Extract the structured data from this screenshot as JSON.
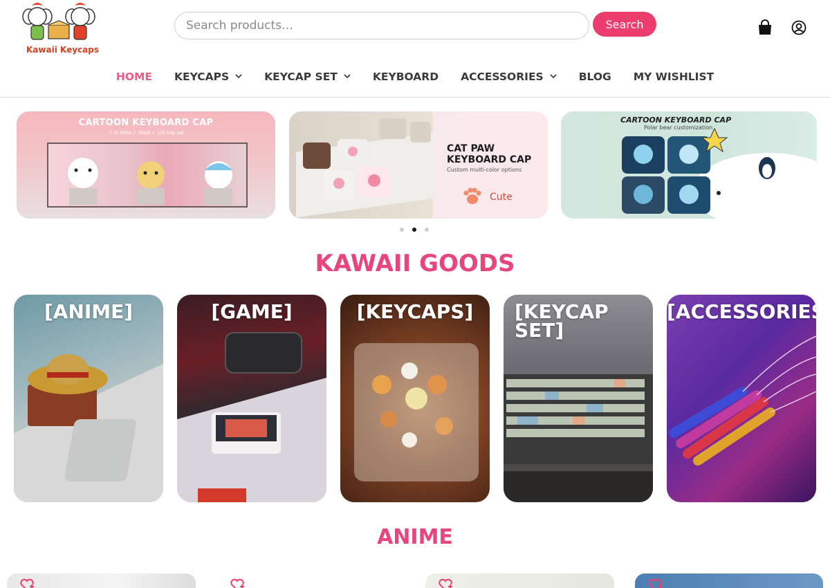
{
  "brand": {
    "logo_text": "Kawaii Keycaps",
    "accent": "#ec3e6c",
    "nav_active": "#ec5d86",
    "section_title_color": "#e8467a"
  },
  "search": {
    "placeholder": "Search products…",
    "button_label": "Search"
  },
  "header_icons": [
    "shopping-bag-icon",
    "user-account-icon"
  ],
  "nav": {
    "items": [
      {
        "label": "HOME",
        "active": true,
        "dropdown": false
      },
      {
        "label": "KEYCAPS",
        "active": false,
        "dropdown": true
      },
      {
        "label": "KEYCAP SET",
        "active": false,
        "dropdown": true
      },
      {
        "label": "KEYBOARD",
        "active": false,
        "dropdown": false
      },
      {
        "label": "ACCESSORIES",
        "active": false,
        "dropdown": true
      },
      {
        "label": "BLOG",
        "active": false,
        "dropdown": false
      },
      {
        "label": "MY WISHLIST",
        "active": false,
        "dropdown": false
      }
    ]
  },
  "banners": [
    {
      "title": "CARTOON KEYBOARD CAP",
      "subtitle": "✓ In Stock   ✓ Stock   ✓ 12h ship out"
    },
    {
      "title_line1": "CAT PAW",
      "title_line2": "KEYBOARD CAP",
      "subtitle": "Custom multi-color options",
      "tag": "Cute"
    },
    {
      "title": "CARTOON KEYBOARD CAP",
      "subtitle": "Polar bear customization"
    }
  ],
  "slider": {
    "dot_count": 3,
    "active_index": 1
  },
  "sections": {
    "kawaii_goods": "KAWAII GOODS",
    "anime": "ANIME"
  },
  "categories": [
    {
      "label": "[ANIME]"
    },
    {
      "label": "[GAME]"
    },
    {
      "label": "[KEYCAPS]"
    },
    {
      "label_line1": "[KEYCAP",
      "label_line2": "SET]"
    },
    {
      "label": "[ACCESSORIES]"
    }
  ],
  "product_row": {
    "count_visible": 4,
    "icon": "heart-plus-icon"
  }
}
